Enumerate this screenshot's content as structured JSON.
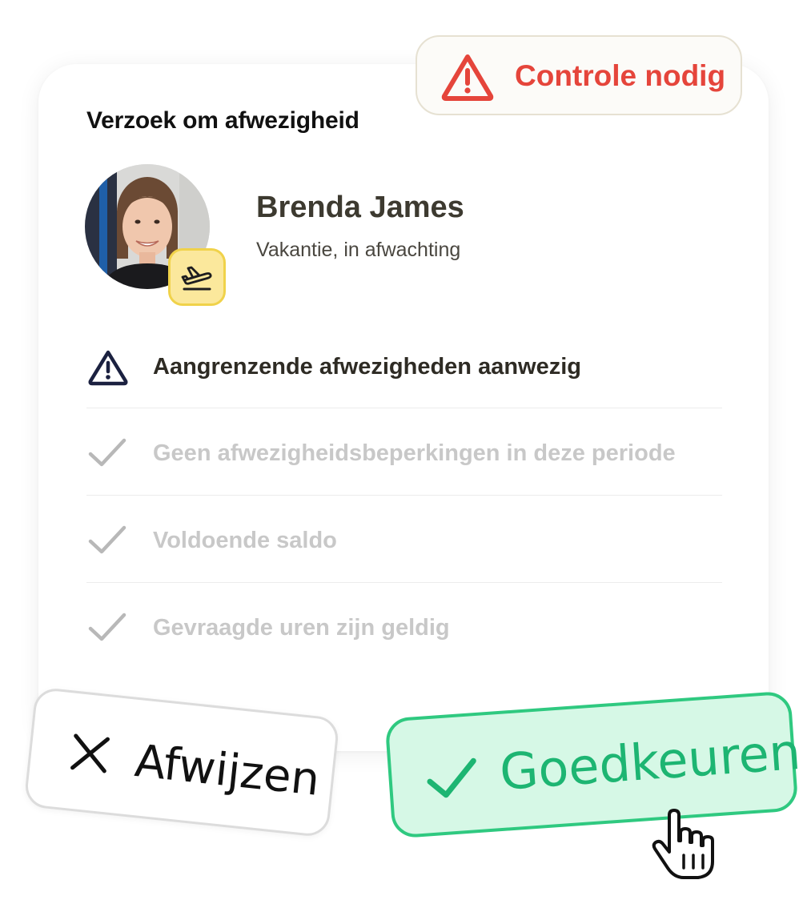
{
  "status_badge": {
    "label": "Controle nodig",
    "icon": "warning-triangle-icon",
    "color": "#e5453b"
  },
  "card": {
    "title": "Verzoek om afwezigheid",
    "person": {
      "name": "Brenda James",
      "status": "Vakantie, in afwachting",
      "avatar": "avatar-photo",
      "leave_type_icon": "plane-departure-icon"
    },
    "checks": [
      {
        "label": "Aangrenzende afwezigheden aanwezig",
        "state": "warning",
        "icon": "warning-triangle-icon"
      },
      {
        "label": "Geen afwezigheidsbeperkingen in deze periode",
        "state": "ok",
        "icon": "check-icon"
      },
      {
        "label": "Voldoende saldo",
        "state": "ok",
        "icon": "check-icon"
      },
      {
        "label": "Gevraagde uren zijn geldig",
        "state": "ok",
        "icon": "check-icon"
      }
    ]
  },
  "actions": {
    "reject_label": "Afwijzen",
    "approve_label": "Goedkeuren",
    "approve_color": "#1db572"
  }
}
